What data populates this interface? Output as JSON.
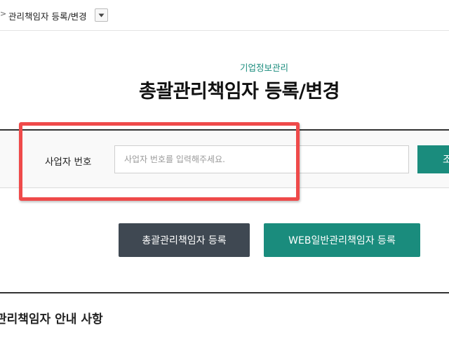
{
  "breadcrumb": {
    "arrow": ">",
    "current": "관리책임자 등록/변경"
  },
  "page": {
    "subtitle": "기업정보관리",
    "title": "총괄관리책임자 등록/변경"
  },
  "search": {
    "label": "사업자 번호",
    "value": "",
    "placeholder": "사업자 번호를 입력해주세요.",
    "button_label": "조회"
  },
  "actions": {
    "register_general_label": "총괄관리책임자 등록",
    "register_web_label": "WEB일반관리책임자 등록"
  },
  "notice": {
    "title": "관리책임자 안내 사항"
  },
  "colors": {
    "accent": "#1a8c7d",
    "dark_button": "#3f4852",
    "highlight": "#ef4a4a"
  }
}
